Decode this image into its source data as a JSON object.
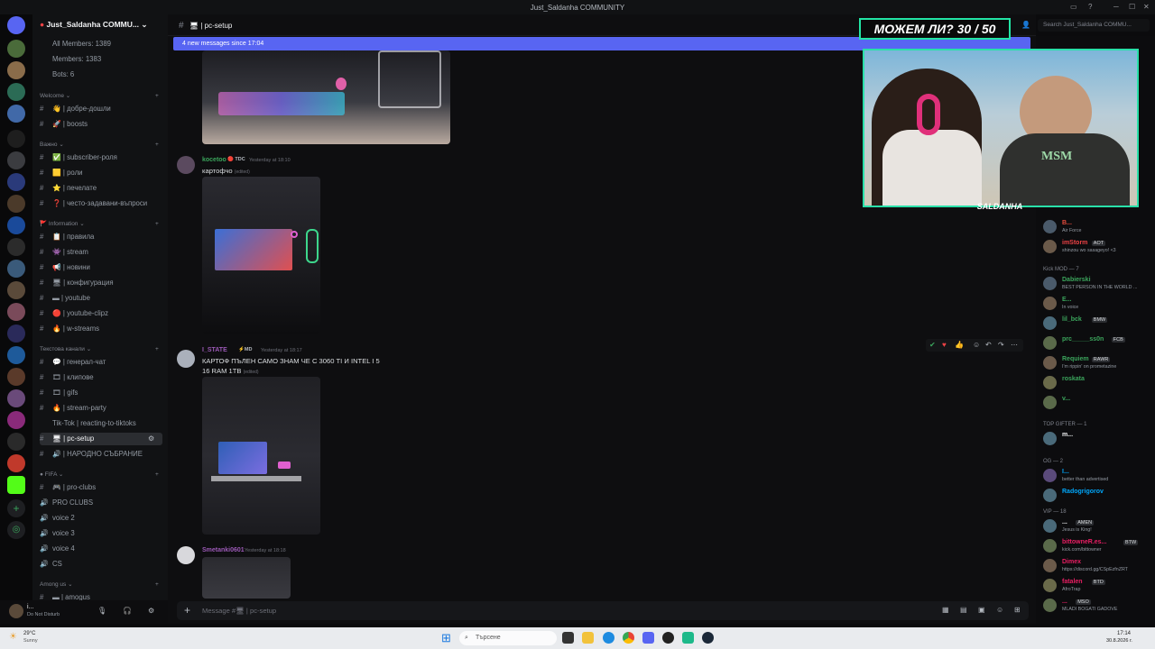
{
  "window": {
    "title": "Just_Saldanha COMMUNITY"
  },
  "server": {
    "name": "Just_Saldanha COMMU..."
  },
  "stats": [
    "All Members: 1389",
    "Members: 1383",
    "Bots: 6"
  ],
  "categories": {
    "welcome": "Welcome",
    "important": "Важно",
    "information": "Information",
    "text": "Текстова канали",
    "fifa": "FIFA",
    "among": "Among us"
  },
  "channels": {
    "welcome": [
      "👋 | добре-дошли",
      "🚀 | boosts"
    ],
    "important": [
      "✅ | subscriber-роля",
      "🟨 | роли",
      "⭐ | печелате",
      "❓ | често-задавани-въпроси"
    ],
    "information": [
      "📋 | правила",
      "👾 | stream",
      "📢 | новини",
      "🖥 | конфигурация",
      "▬ | youtube",
      "🔴 | youtube-clipz",
      "🔥 | w-streams"
    ],
    "text": [
      "💬 | генерал-чат",
      "🎞 | клипове",
      "🎞 | gifs",
      "🔥 | stream-party",
      "Tik-Tok | reacting-to-tiktoks",
      "🖥 | pc-setup",
      "🔊 | НАРОДНО СЪБРАНИЕ"
    ],
    "fifa": [
      "🎮 | pro-clubs",
      "PRO CLUBS",
      "voice 2",
      "voice 3",
      "voice 4",
      "CS"
    ],
    "among": [
      "▬ | amogus"
    ]
  },
  "channel": {
    "name": "🖥 | pc-setup"
  },
  "banner": {
    "text": "4 new messages since 17:04"
  },
  "messages": [
    {
      "user": "kocetoo",
      "tag": "TDC",
      "time": "Yesterday at 18:10",
      "text": "картофчо",
      "edited": "(edited)"
    },
    {
      "user": "I_STATE",
      "tag": "MD",
      "time": "Yesterday at 18:17",
      "line1": "КАРТОФ ПЪЛЕН САМО ЗНАМ ЧЕ С 3060 TI И INTEL I 5",
      "line2": "16 RAM 1TB",
      "edited": "(edited)"
    },
    {
      "user": "Smetanki0601",
      "time": "Yesterday at 18:18"
    }
  ],
  "composer": {
    "placeholder": "Message #🖥 | pc-setup"
  },
  "search": {
    "placeholder": "Search Just_Saldanha COMMU..."
  },
  "overlay": {
    "title": "МОЖЕМ ЛИ? 30 / 50",
    "streamer": "SALDANHA"
  },
  "members": {
    "top": [
      {
        "name": "B...",
        "status": "Air Force",
        "color": "#e74c3c"
      },
      {
        "name": "imStorm",
        "tag": "AOT",
        "status": "shinzou wo sasageyo! <3",
        "color": "#ed4245"
      }
    ],
    "kick_header": "Kick MOD — 7",
    "kick": [
      {
        "name": "Dabierski",
        "status": "BEST PERSON IN THE WORLD ...",
        "color": "#3ba55c"
      },
      {
        "name": "E...",
        "status": "In voice",
        "color": "#3ba55c"
      },
      {
        "name": "lil_bck",
        "tag": "BMW",
        "status": "",
        "color": "#3ba55c"
      },
      {
        "name": "prc_____ss0n",
        "tag": "FCB",
        "status": "",
        "color": "#3ba55c"
      },
      {
        "name": "Requiem",
        "tag": "RAWR",
        "status": "I'm rippin' on prometazine",
        "color": "#3ba55c"
      },
      {
        "name": "roskata",
        "status": "",
        "color": "#3ba55c"
      },
      {
        "name": "v...",
        "status": "",
        "color": "#3ba55c"
      }
    ],
    "gifter_header": "TOP GIFTER — 1",
    "gifter": [
      {
        "name": "m...",
        "status": "",
        "color": "#f2f3f5"
      }
    ],
    "og_header": "OG — 2",
    "og": [
      {
        "name": "I...",
        "status": "better than advertised",
        "color": "#00a8fc"
      },
      {
        "name": "Radogrigorov",
        "status": "",
        "color": "#00a8fc"
      }
    ],
    "vip_header": "VIP — 18",
    "vip": [
      {
        "name": "...",
        "tag": "AMEN",
        "status": "Jesus is King!",
        "color": "#f2f3f5"
      },
      {
        "name": "bittowneR.es...",
        "tag": "BTW",
        "status": "kick.com/bittowner",
        "color": "#e91e63"
      },
      {
        "name": "Dimex",
        "status": "https://discord.gg/CSpEzfnZRT",
        "color": "#e91e63"
      },
      {
        "name": "fatalen",
        "tag": "BTD",
        "status": "AfroTrap",
        "color": "#e91e63"
      },
      {
        "name": "...",
        "tag": "MSO",
        "status": "MLADI BOGATI GADOVE",
        "color": "#e91e63"
      }
    ]
  },
  "user": {
    "name": "i...",
    "status": "Do Not Disturb"
  },
  "taskbar": {
    "weather_temp": "29°C",
    "weather_desc": "Sunny",
    "search": "Търсене",
    "time": "17:14",
    "date": "30.8.2026 г."
  }
}
